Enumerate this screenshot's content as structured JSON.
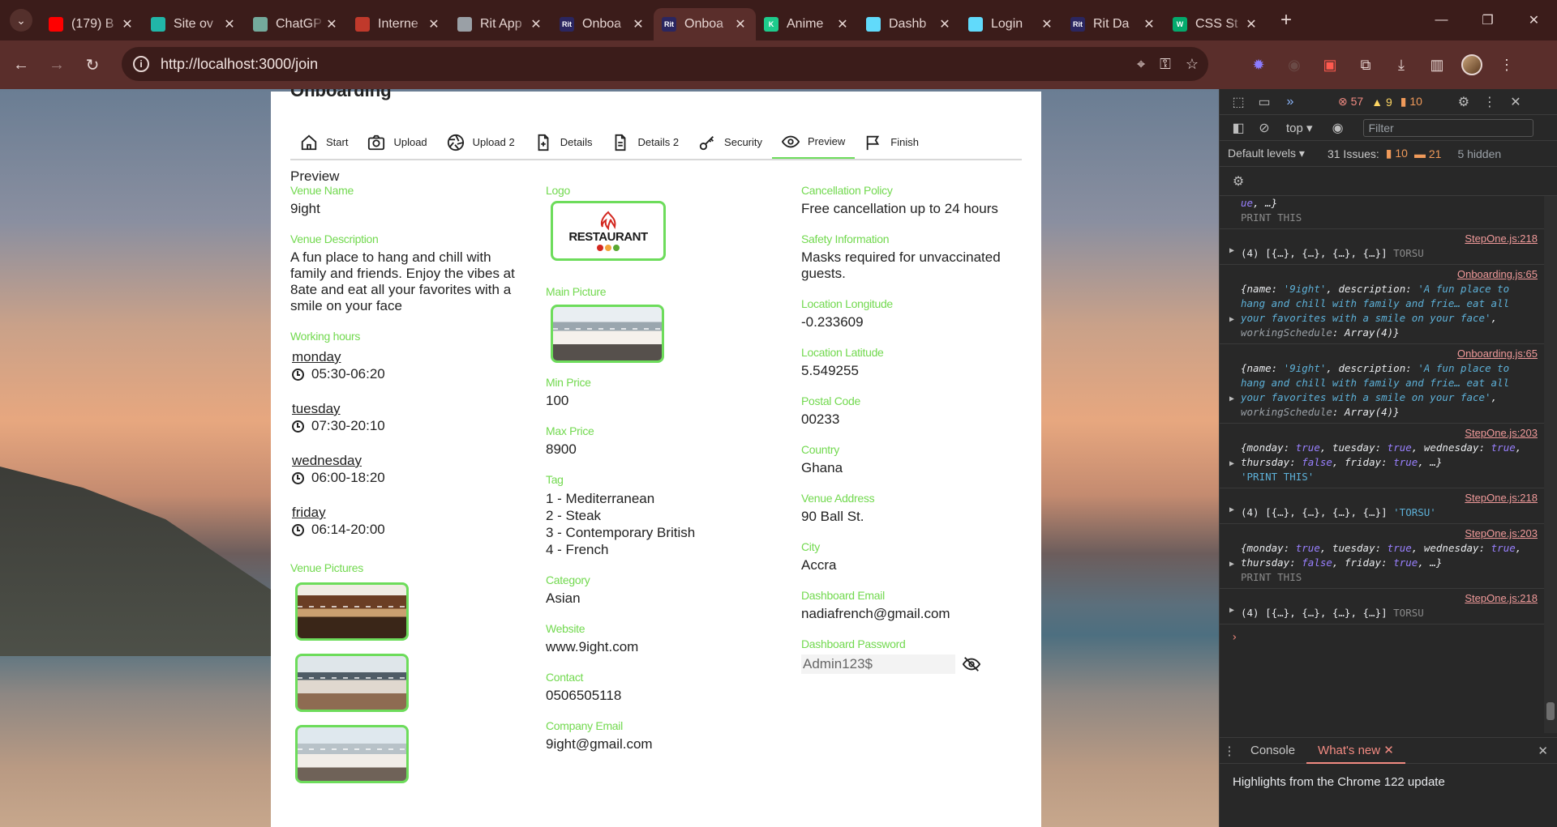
{
  "browser": {
    "tabs": [
      {
        "title": "(179) B",
        "icon": "youtube-icon",
        "color": "#ff0000"
      },
      {
        "title": "Site ov",
        "icon": "diamond-icon",
        "color": "#21b6a8"
      },
      {
        "title": "ChatGP",
        "icon": "chatgpt-icon",
        "color": "#74aa9c"
      },
      {
        "title": "Interne",
        "icon": "speedometer-icon",
        "color": "#c0392b"
      },
      {
        "title": "Rit App",
        "icon": "globe-icon",
        "color": "#9aa0a6"
      },
      {
        "title": "Onboa",
        "icon": "rit-logo-icon",
        "color": "#2b2660",
        "label": "Rit"
      },
      {
        "title": "Onboa",
        "icon": "rit-logo-icon",
        "color": "#2b2660",
        "label": "Rit",
        "active": true
      },
      {
        "title": "Anime",
        "icon": "k-logo-icon",
        "color": "#1ecb8c",
        "label": "K"
      },
      {
        "title": "Dashb",
        "icon": "react-icon",
        "color": "#61dafb"
      },
      {
        "title": "Login",
        "icon": "react-icon",
        "color": "#61dafb"
      },
      {
        "title": "Rit Da",
        "icon": "rit-logo-icon",
        "color": "#2b2660",
        "label": "Rit"
      },
      {
        "title": "CSS St",
        "icon": "w-logo-icon",
        "color": "#04aa6d",
        "label": "W"
      }
    ],
    "url": "http://localhost:3000/join"
  },
  "card": {
    "title": "Onboarding",
    "steps": [
      "Start",
      "Upload",
      "Upload 2",
      "Details",
      "Details 2",
      "Security",
      "Preview",
      "Finish"
    ],
    "preview_title": "Preview"
  },
  "col1": {
    "venue_name_label": "Venue Name",
    "venue_name": "9ight",
    "venue_description_label": "Venue Description",
    "venue_description": "A fun place to hang and chill with family and friends. Enjoy the vibes at 8ate and eat all your favorites with a smile on your face",
    "working_hours_label": "Working hours",
    "days": [
      {
        "day": "monday",
        "time": "05:30-06:20"
      },
      {
        "day": "tuesday",
        "time": "07:30-20:10"
      },
      {
        "day": "wednesday",
        "time": "06:00-18:20"
      },
      {
        "day": "friday",
        "time": "06:14-20:00"
      }
    ],
    "venue_pictures_label": "Venue Pictures"
  },
  "col2": {
    "logo_label": "Logo",
    "logo_text": "RESTAURANT",
    "main_picture_label": "Main Picture",
    "min_price_label": "Min Price",
    "min_price": "100",
    "max_price_label": "Max Price",
    "max_price": "8900",
    "tag_label": "Tag",
    "tags": [
      "1 - Mediterranean",
      "2 - Steak",
      "3 - Contemporary British",
      "4 - French"
    ],
    "category_label": "Category",
    "category": "Asian",
    "website_label": "Website",
    "website": "www.9ight.com",
    "contact_label": "Contact",
    "contact": "0506505118",
    "company_email_label": "Company Email",
    "company_email": "9ight@gmail.com"
  },
  "col3": {
    "cancellation_label": "Cancellation Policy",
    "cancellation": "Free cancellation up to 24 hours",
    "safety_label": "Safety Information",
    "safety": "Masks required for unvaccinated guests.",
    "longitude_label": "Location Longitude",
    "longitude": "-0.233609",
    "latitude_label": "Location Latitude",
    "latitude": "5.549255",
    "postal_label": "Postal Code",
    "postal": "00233",
    "country_label": "Country",
    "country": "Ghana",
    "address_label": "Venue Address",
    "address": "90 Ball St.",
    "city_label": "City",
    "city": "Accra",
    "dash_email_label": "Dashboard Email",
    "dash_email": "nadiafrench@gmail.com",
    "dash_password_label": "Dashboard Password",
    "dash_password": "Admin123$"
  },
  "devtools": {
    "errors": "57",
    "warnings": "9",
    "messages": "10",
    "context": "top",
    "filter_placeholder": "Filter",
    "levels": "Default levels",
    "issues_label": "31 Issues:",
    "issues_warn": "10",
    "issues_msg": "21",
    "hidden": "5 hidden",
    "drawer_tab1": "Console",
    "drawer_tab2": "What's new",
    "drawer_text": "Highlights from the Chrome 122 update"
  }
}
